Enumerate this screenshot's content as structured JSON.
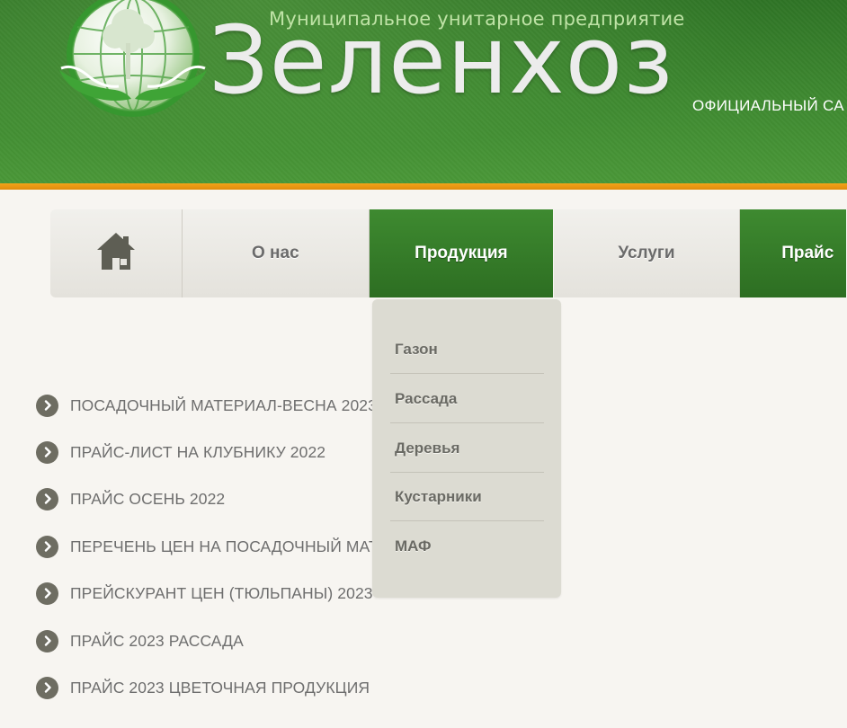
{
  "header": {
    "subtitle": "Муниципальное унитарное предприятие",
    "brand": "Зеленхоз",
    "official": "ОФИЦИАЛЬНЫЙ СА",
    "colors": {
      "green": "#3f8a31",
      "orange": "#f2a31a"
    }
  },
  "nav": {
    "home_icon": "home-icon",
    "items": [
      {
        "label": "О нас"
      },
      {
        "label": "Продукция"
      },
      {
        "label": "Услуги"
      },
      {
        "label": "Прайс"
      }
    ]
  },
  "dropdown": {
    "items": [
      {
        "label": "Газон"
      },
      {
        "label": "Рассада"
      },
      {
        "label": "Деревья"
      },
      {
        "label": "Кустарники"
      },
      {
        "label": "МАФ"
      }
    ]
  },
  "list": {
    "bullet_icon": "chevron-right-icon",
    "items": [
      {
        "label": "ПОСАДОЧНЫЙ МАТЕРИАЛ-ВЕСНА 2023"
      },
      {
        "label": "ПРАЙС-ЛИСТ НА КЛУБНИКУ 2022"
      },
      {
        "label": "ПРАЙС ОСЕНЬ 2022"
      },
      {
        "label": "ПЕРЕЧЕНЬ ЦЕН НА ПОСАДОЧНЫЙ МАТЕРИАЛ"
      },
      {
        "label": "ПРЕЙСКУРАНТ ЦЕН (ТЮЛЬПАНЫ) 2023"
      },
      {
        "label": "ПРАЙС 2023 РАССАДА"
      },
      {
        "label": "ПРАЙС 2023 ЦВЕТОЧНАЯ ПРОДУКЦИЯ"
      }
    ]
  }
}
